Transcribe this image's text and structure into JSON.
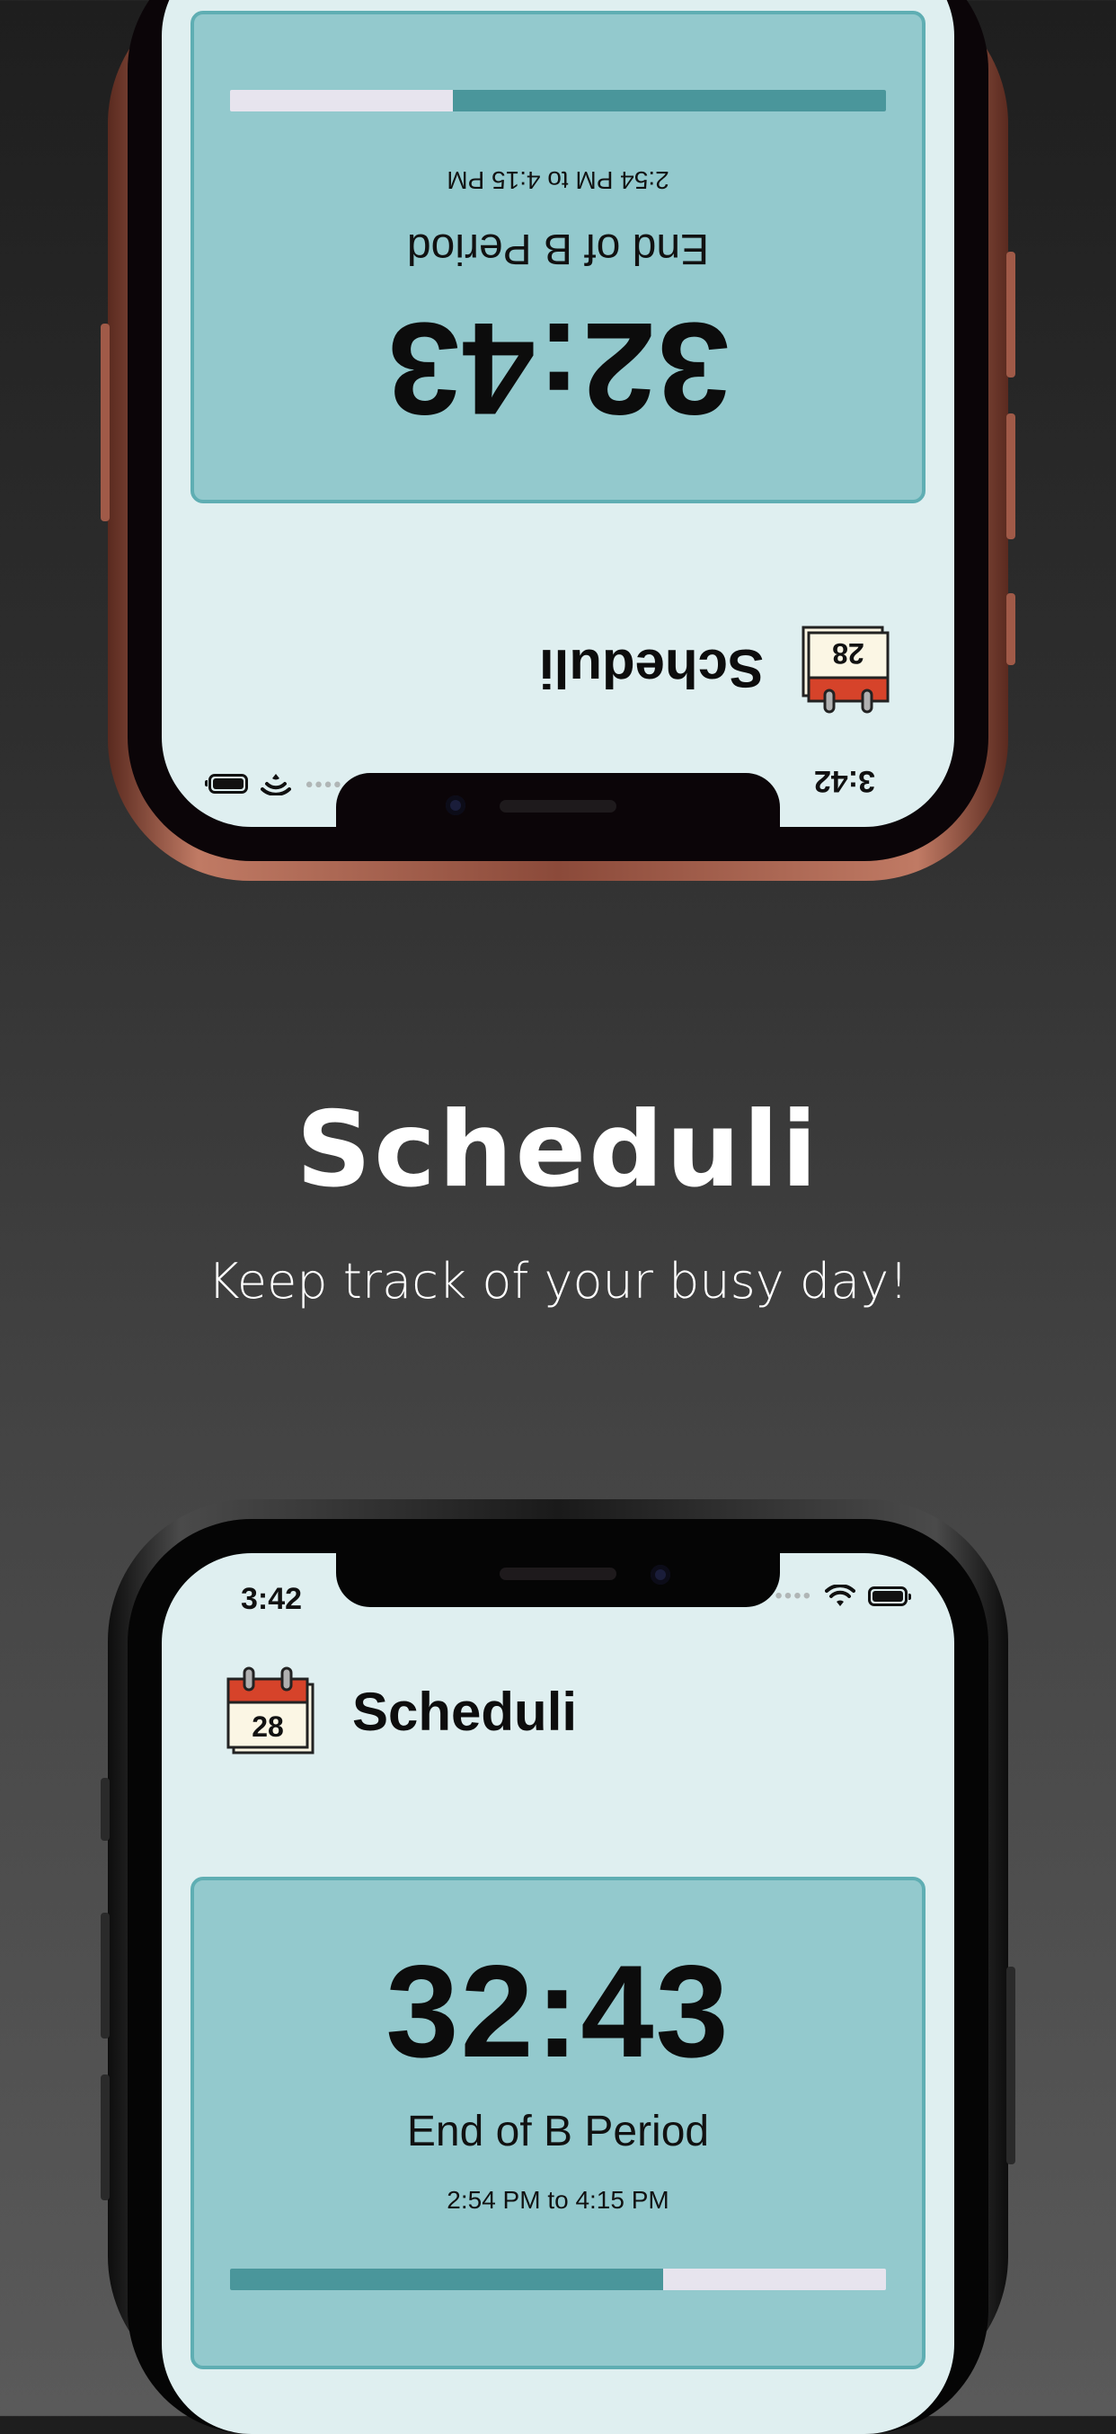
{
  "promo": {
    "title": "Scheduli",
    "subtitle": "Keep track of your busy day!"
  },
  "status_bar": {
    "time": "3:42",
    "icons": [
      "signal-dots-icon",
      "wifi-icon",
      "battery-icon"
    ]
  },
  "app": {
    "name": "Scheduli",
    "calendar_icon_day": "28"
  },
  "timer": {
    "countdown": "32:43",
    "period_name": "End of B Period",
    "period_range": "2:54 PM to 4:15 PM",
    "progress": 0.66
  },
  "colors": {
    "screen_bg": "#dfeff0",
    "card_bg": "#93c9cd",
    "card_border": "#5faeb3",
    "progress_fill": "#4a969b",
    "progress_track": "#e7e4ee",
    "calendar_red": "#d6432a"
  }
}
